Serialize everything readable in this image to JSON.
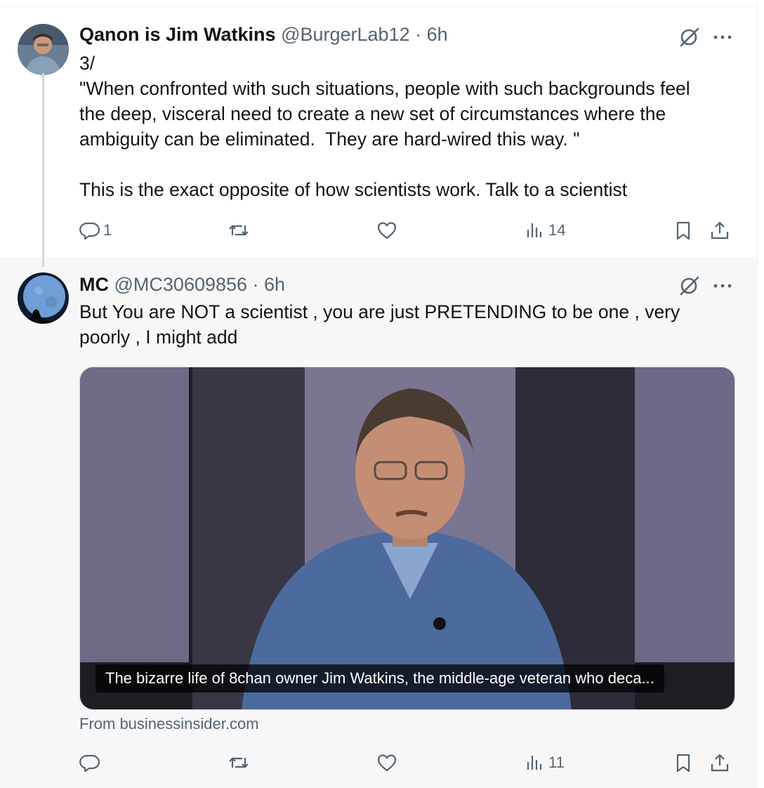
{
  "tweets": [
    {
      "author_name": "Qanon is Jim Watkins",
      "handle_time": "@BurgerLab12 · 6h",
      "lines": [
        "3/",
        "\"When confronted with such situations, people with such backgrounds feel",
        "the deep, visceral need to create a new set of circumstances where the",
        "ambiguity can be eliminated.  They are hard-wired this way. \""
      ],
      "last_line": "This is the exact opposite of how scientists work. Talk to a scientist",
      "reply_count": "1",
      "views_count": "14"
    },
    {
      "author_name": "MC",
      "handle_time": "@MC30609856 · 6h",
      "lines": [
        "But You are NOT a scientist , you are just PRETENDING to be one , very",
        "poorly , I might add"
      ],
      "card_caption": "The bizarre life of 8chan owner Jim Watkins, the middle-age veteran who deca...",
      "card_source": "From businessinsider.com",
      "views_count": "11"
    }
  ],
  "icons": {
    "reply": "reply-icon",
    "retweet": "retweet-icon",
    "like": "like-icon",
    "views": "views-icon",
    "bookmark": "bookmark-icon",
    "share": "share-icon",
    "grok": "grok-icon",
    "more": "more-icon"
  },
  "colors": {
    "text": "#0f1419",
    "secondary": "#536471",
    "thread_line": "#cfd9de",
    "reply_background": "#f7f7f7"
  }
}
